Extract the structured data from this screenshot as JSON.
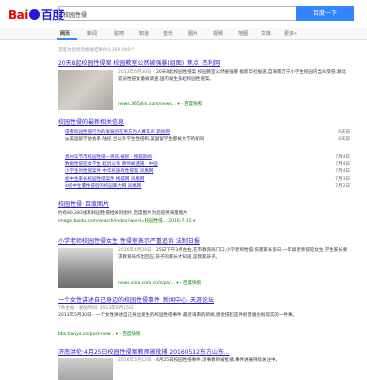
{
  "header": {
    "logo_left": "Bai",
    "logo_right": "百度",
    "search_query": "校园性侵",
    "search_button": "百度一下"
  },
  "tabs": [
    "网页",
    "新闻",
    "贴吧",
    "知道",
    "音乐",
    "图片",
    "视频",
    "地图",
    "文库",
    "更多»"
  ],
  "result_count": "百度为您找到相关结果约2,360,000个",
  "results": [
    {
      "title": "20天8起校园性侵案 校园教室公然被强暴(组图)_焦点_杰利网",
      "date": "2013年6月30日 -",
      "snippet": "20天8起校园性侵案 校园教室公然被强暴 据新华社报道,自海南万宁小学生校园内当众受侵,湖北官员性侵女童被调查,国内发生多起校园性侵案。",
      "source": "news.365jilin.com/news... ▾ - 百度快照"
    },
    {
      "title": "校园性侵的最新相关信息",
      "news": [
        {
          "title": "侵害校园性侵行为的发展因在男方为人赛车声 新民网",
          "date": "4天前"
        },
        {
          "title": "@美国留学协会系 陆纪 吕以外学生性侵和,美国留学生都被大学的如同",
          "date": "4天前"
        },
        {
          "title": "贵州毕节市校园性侵一男孩,被抓 · 搜狐新闻",
          "date": "7月4日"
        },
        {
          "title": "数据性侵犯女学生 起诉父亲 教师被逮捕 · 中国",
          "date": "7月4日"
        },
        {
          "title": "小学生的性侵案件 中华民族有性侵案 凤凰网",
          "date": "7月4日"
        },
        {
          "title": "初中生家长校园性侵案件 搜狐网 凤凰网",
          "date": "7月3日"
        },
        {
          "title": "4初中生遭性侵后的校园暴力网 凤凰网",
          "date": "7月2日"
        }
      ]
    },
    {
      "title": "校园性侵_百度图片",
      "snippet": "约有80,283张和校园性侵相关的图片,百度图片为您提供海量图片",
      "source": "image.baidu.com/search/index?word=校园性侵... 2016-7-15 ▾"
    },
    {
      "title": "小学老师校园性侵女生 性侵室表示严重追诉 法制日报",
      "date": "2016年4月29日 -",
      "snippet": "25日下午3点左右,在市教育局门口,小学老师性侵,伤害家长多日,一年级老师侵犯女生,学生家长要求教育局作出回应,孩子的家长才知道,是我家孩子。",
      "source": "news.sina.com.cn/s/pa/... ▾ - 百度快照"
    },
    {
      "title": "一个女性讲述自己身边的校园性侵事件_新闻中心_天涯论坛",
      "date": "7条主帖 - 发帖时间: 2013年6月15日",
      "snippet": "2013年5月30日 - 一个女性讲述自己身边发生的校园性侵事件 最近海南的新闻,感觉侵犯是件很普遍也很现实的一件事。",
      "source": "bbs.tianya.cn/post-new... ▾ - 百度快照"
    },
    {
      "title": "济南洪伦:4月25日校园性侵案教师被批捕 20160512东方山东...",
      "date": "2016年5月12日 -",
      "snippet": "4月25日校园性侵事件,涉事教师被批捕,事件进展持续关注中。",
      "source": ""
    }
  ]
}
